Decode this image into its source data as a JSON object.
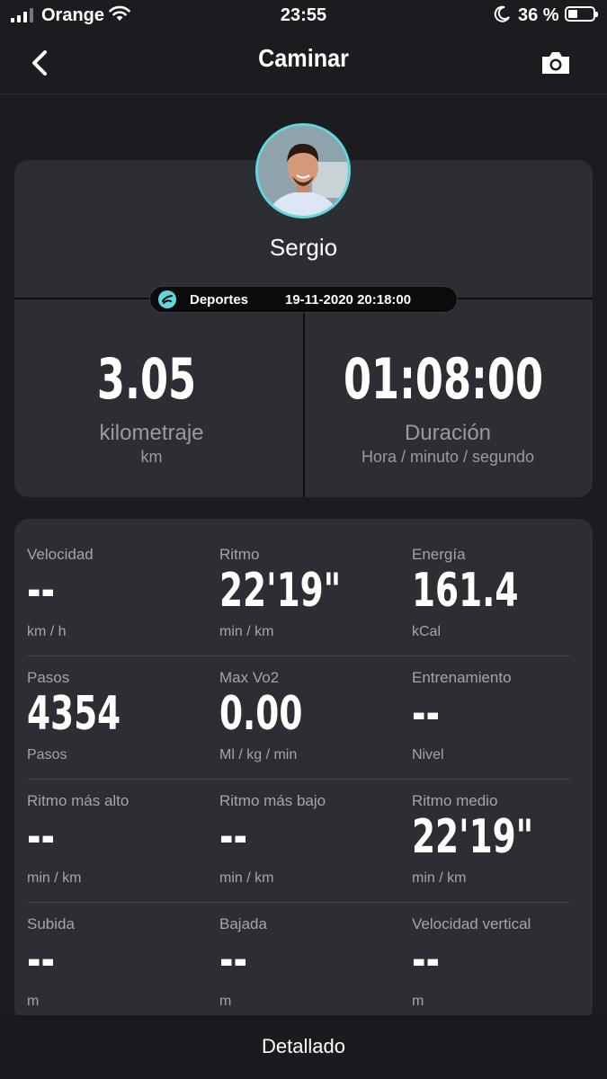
{
  "status_bar": {
    "carrier": "Orange",
    "time": "23:55",
    "battery_percent": "36 %",
    "battery_level": 0.36
  },
  "nav": {
    "title": "Caminar"
  },
  "profile": {
    "name": "Sergio",
    "activity_type": "Deportes",
    "datetime": "19-11-2020 20:18:00",
    "accent_color": "#5fd7dd"
  },
  "summary": {
    "distance": {
      "value": "3.05",
      "label": "kilometraje",
      "unit": "km"
    },
    "duration": {
      "value": "01:08:00",
      "label": "Duración",
      "unit": "Hora / minuto / segundo"
    }
  },
  "stats": [
    {
      "title": "Velocidad",
      "value": "--",
      "unit": "km / h"
    },
    {
      "title": "Ritmo",
      "value": "22'19\"",
      "unit": "min / km"
    },
    {
      "title": "Energía",
      "value": "161.4",
      "unit": "kCal"
    },
    {
      "title": "Pasos",
      "value": "4354",
      "unit": "Pasos"
    },
    {
      "title": "Max Vo2",
      "value": "0.00",
      "unit": "Ml / kg / min"
    },
    {
      "title": "Entrenamiento",
      "value": "--",
      "unit": "Nivel"
    },
    {
      "title": "Ritmo más alto",
      "value": "--",
      "unit": "min / km"
    },
    {
      "title": "Ritmo más bajo",
      "value": "--",
      "unit": "min / km"
    },
    {
      "title": "Ritmo medio",
      "value": "22'19\"",
      "unit": "min / km"
    },
    {
      "title": "Subida",
      "value": "--",
      "unit": "m"
    },
    {
      "title": "Bajada",
      "value": "--",
      "unit": "m"
    },
    {
      "title": "Velocidad vertical",
      "value": "--",
      "unit": "m"
    }
  ],
  "footer": {
    "button_label": "Detallado"
  }
}
